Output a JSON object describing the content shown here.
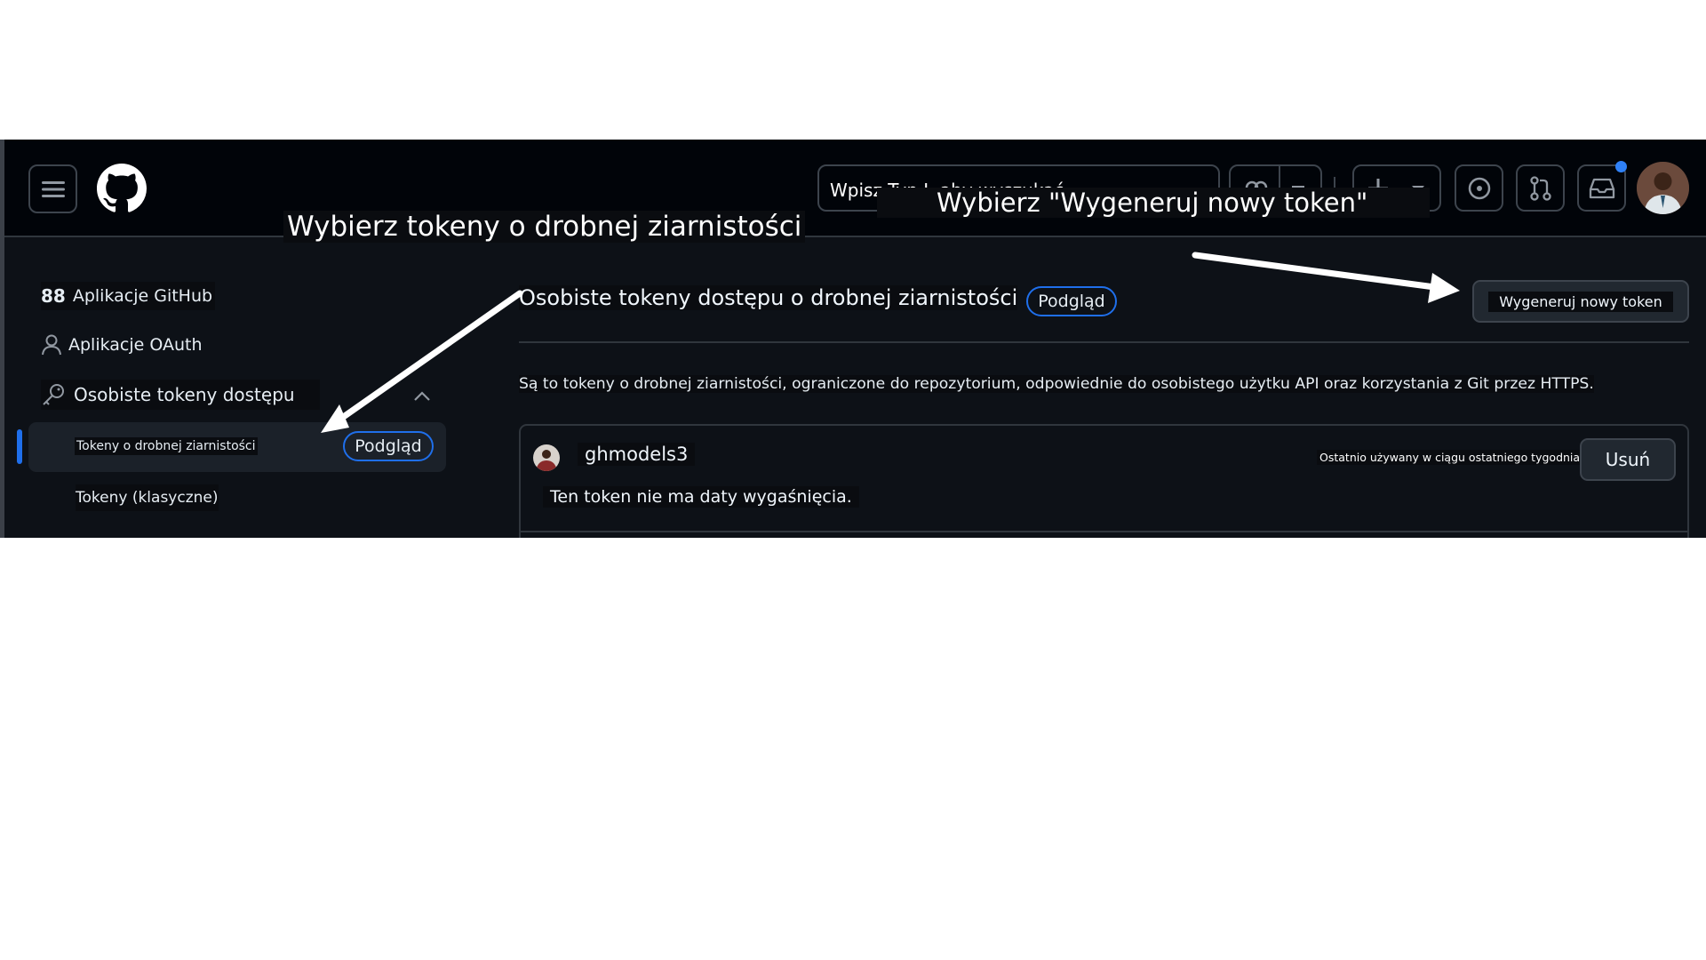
{
  "annotations": {
    "fine_grained_callout": "Wybierz tokeny o drobnej ziarnistości",
    "generate_callout": "Wybierz \"Wygeneruj nowy token\""
  },
  "header": {
    "search_placeholder": "Wpisz Typ I, aby wyszukać",
    "notification_dot_color": "#2f81f7"
  },
  "sidebar": {
    "github_apps_glyph": "88",
    "github_apps_label": "Aplikacje GitHub",
    "oauth_label": "Aplikacje OAuth",
    "pat_label": "Osobiste tokeny dostępu",
    "fine_grained_label": "Tokeny o drobnej ziarnistości",
    "fine_grained_badge": "Podgląd",
    "classic_label": "Tokeny (klasyczne)"
  },
  "main": {
    "title": "Osobiste tokeny dostępu o drobnej ziarnistości",
    "title_badge": "Podgląd",
    "generate_button": "Wygeneruj nowy token",
    "description": "Są to tokeny o drobnej ziarnistości, ograniczone do repozytorium, odpowiednie do osobistego użytku API oraz korzystania z Git przez HTTPS.",
    "token": {
      "name": "ghmodels3",
      "last_used": "Ostatnio używany w ciągu ostatniego tygodnia",
      "expiry": "Ten token nie ma daty wygaśnięcia.",
      "delete_button": "Usuń"
    }
  },
  "colors": {
    "accent": "#1f6feb",
    "background": "#0d1117",
    "header_background": "#010409"
  }
}
